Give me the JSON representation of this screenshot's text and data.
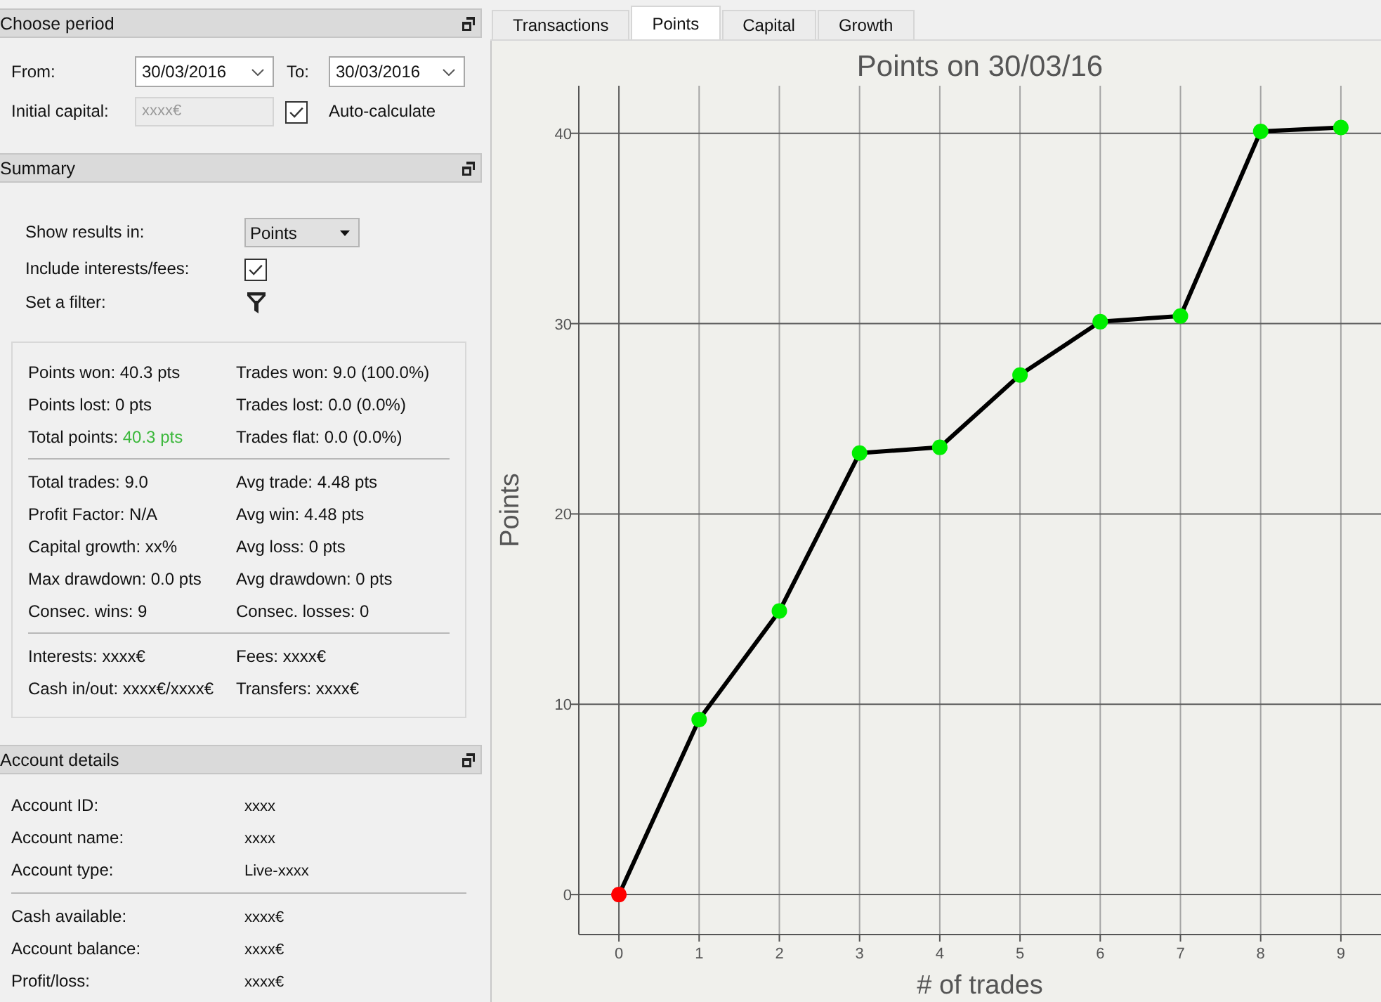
{
  "choose_period": {
    "title": "Choose period",
    "from_label": "From:",
    "from_date": "30/03/2016",
    "to_label": "To:",
    "to_date": "30/03/2016",
    "initial_capital_label": "Initial capital:",
    "initial_capital": {
      "value": "xxxx€",
      "disabled": true
    },
    "auto_calculate": {
      "label": "Auto-calculate",
      "checked": true
    }
  },
  "summary": {
    "title": "Summary",
    "show_results_label": "Show results in:",
    "show_results_value": "Points",
    "include_fees": {
      "label": "Include interests/fees:",
      "checked": true
    },
    "filter_label": "Set a filter:",
    "stats": [
      {
        "items": [
          {
            "label": "Points won:",
            "value": "40.3 pts"
          },
          {
            "label": "Trades won:",
            "value": "9.0 (100.0%)"
          },
          {
            "label": "Points lost:",
            "value": "0 pts"
          },
          {
            "label": "Trades lost:",
            "value": "0.0 (0.0%)"
          },
          {
            "label": "Total points:",
            "value": "40.3 pts",
            "color": "#3cb83c"
          },
          {
            "label": "Trades flat:",
            "value": "0.0 (0.0%)"
          }
        ]
      },
      {
        "items": [
          {
            "label": "Total trades:",
            "value": "9.0"
          },
          {
            "label": "Avg trade:",
            "value": "4.48 pts"
          },
          {
            "label": "Profit Factor:",
            "value": "N/A"
          },
          {
            "label": "Avg win:",
            "value": "4.48 pts"
          },
          {
            "label": "Capital growth:",
            "value": "xx%"
          },
          {
            "label": "Avg loss:",
            "value": "0 pts"
          },
          {
            "label": "Max drawdown:",
            "value": "0.0 pts"
          },
          {
            "label": "Avg drawdown:",
            "value": "0 pts"
          },
          {
            "label": "Consec. wins:",
            "value": "9"
          },
          {
            "label": "Consec. losses:",
            "value": "0"
          }
        ]
      },
      {
        "items": [
          {
            "label": "Interests:",
            "value": "xxxx€"
          },
          {
            "label": "Fees:",
            "value": "xxxx€"
          },
          {
            "label": "Cash in/out:",
            "value": "xxxx€/xxxx€"
          },
          {
            "label": "Transfers:",
            "value": "xxxx€"
          }
        ]
      }
    ]
  },
  "account_details": {
    "title": "Account details",
    "groups": [
      {
        "rows": [
          {
            "label": "Account ID:",
            "value": "xxxx"
          },
          {
            "label": "Account name:",
            "value": "xxxx"
          },
          {
            "label": "Account type:",
            "value": "Live-xxxx"
          }
        ]
      },
      {
        "rows": [
          {
            "label": "Cash available:",
            "value": "xxxx€"
          },
          {
            "label": "Account balance:",
            "value": "xxxx€"
          },
          {
            "label": "Profit/loss:",
            "value": "xxxx€"
          }
        ]
      }
    ]
  },
  "tabs": [
    {
      "label": "Transactions",
      "selected": false
    },
    {
      "label": "Points",
      "selected": true
    },
    {
      "label": "Capital",
      "selected": false
    },
    {
      "label": "Growth",
      "selected": false
    }
  ],
  "points_panel": {
    "chart_data": {
      "type": "line",
      "title": "Points on 30/03/16",
      "xlabel": "# of trades",
      "ylabel": "Points",
      "categories": [
        "0",
        "1",
        "2",
        "3",
        "4",
        "5",
        "6",
        "7",
        "8",
        "9"
      ],
      "series": [
        {
          "color": "#000000",
          "values": [
            0,
            9.2,
            14.9,
            23.2,
            23.5,
            27.3,
            30.1,
            30.4,
            40.1,
            40.3
          ],
          "marker": "circle"
        }
      ],
      "ylim": [
        -2.1,
        42.5
      ],
      "yticks": [
        0,
        10,
        20,
        30,
        40
      ],
      "grid": true
    },
    "point_markers": [
      {
        "color": "#ff0000"
      },
      {
        "color": "#00ee00"
      },
      {
        "color": "#00ee00"
      },
      {
        "color": "#00ee00"
      },
      {
        "color": "#00ee00"
      },
      {
        "color": "#00ee00"
      },
      {
        "color": "#00ee00"
      },
      {
        "color": "#00ee00"
      },
      {
        "color": "#00ee00"
      },
      {
        "color": "#00ee00"
      }
    ]
  }
}
